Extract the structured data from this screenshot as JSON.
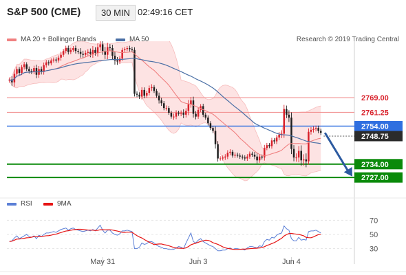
{
  "header": {
    "symbol": "S&P 500 (CME)",
    "timeframe": "30 MIN",
    "time": "02:49:16 CET"
  },
  "legend": {
    "ma20_label": "MA 20 + Bollinger Bands",
    "ma50_label": "MA 50",
    "rsi_label": "RSI",
    "rsi_ma_label": "9MA"
  },
  "credit": "Research © 2019 Trading Central",
  "colors": {
    "up": "#d8202a",
    "down": "#1f1f1f",
    "ma20": "#f08080",
    "band_fill": "#fde3e3",
    "ma50": "#4a6fa5",
    "resistance": "#f08a8a",
    "support": "#0a8a0a",
    "pivot": "#2f6fe0",
    "current": "#2b2b2b",
    "arrow": "#2c5aa0",
    "rsi": "#5b7fd6",
    "rsi_ma": "#e61414"
  },
  "chart_data": [
    {
      "type": "candlestick",
      "title": "S&P 500 (CME) 30 MIN",
      "x_labels": [
        "May 31",
        "Jun 3",
        "Jun 4"
      ],
      "ylim": [
        2722,
        2795
      ],
      "y_axis_side": "right",
      "grid": false,
      "legend_position": "top-left",
      "price_levels": [
        {
          "label": "2769.00",
          "value": 2769.0,
          "kind": "resistance"
        },
        {
          "label": "2761.25",
          "value": 2761.25,
          "kind": "resistance"
        },
        {
          "label": "2754.00",
          "value": 2754.0,
          "kind": "pivot"
        },
        {
          "label": "2748.75",
          "value": 2748.75,
          "kind": "current"
        },
        {
          "label": "2734.00",
          "value": 2734.0,
          "kind": "support"
        },
        {
          "label": "2727.00",
          "value": 2727.0,
          "kind": "support"
        }
      ],
      "forecast_arrow": {
        "from": 2750.5,
        "to": 2727.5
      },
      "close": [
        2778.5,
        2777.0,
        2781.5,
        2784.0,
        2782.0,
        2785.0,
        2786.5,
        2784.0,
        2783.0,
        2782.5,
        2784.5,
        2781.0,
        2784.0,
        2782.5,
        2786.0,
        2787.5,
        2787.0,
        2788.5,
        2789.0,
        2788.5,
        2790.0,
        2791.5,
        2793.5,
        2795.0,
        2793.0,
        2794.0,
        2795.0,
        2793.5,
        2793.0,
        2792.0,
        2791.5,
        2792.5,
        2793.0,
        2792.0,
        2794.0,
        2792.5,
        2795.5,
        2797.0,
        2793.5,
        2791.5,
        2795.5,
        2795.0,
        2791.0,
        2788.5,
        2788.0,
        2789.5,
        2794.0,
        2794.5,
        2795.0,
        2794.5,
        2794.0,
        2771.0,
        2770.5,
        2769.5,
        2773.0,
        2770.0,
        2771.5,
        2774.0,
        2774.5,
        2772.5,
        2770.0,
        2767.5,
        2766.0,
        2763.5,
        2763.5,
        2761.0,
        2759.0,
        2759.0,
        2761.0,
        2760.5,
        2761.0,
        2760.0,
        2762.0,
        2765.5,
        2767.5,
        2760.5,
        2759.0,
        2762.5,
        2764.5,
        2760.0,
        2758.5,
        2755.5,
        2753.0,
        2751.5,
        2744.5,
        2737.0,
        2737.0,
        2737.5,
        2738.0,
        2740.0,
        2740.5,
        2738.5,
        2739.0,
        2738.5,
        2738.0,
        2737.5,
        2737.0,
        2738.0,
        2739.5,
        2739.0,
        2738.0,
        2736.0,
        2738.0,
        2737.5,
        2742.5,
        2744.0,
        2743.5,
        2746.5,
        2746.0,
        2748.0,
        2749.5,
        2750.0,
        2763.0,
        2760.0,
        2758.5,
        2742.0,
        2737.5,
        2737.5,
        2741.0,
        2736.0,
        2736.5,
        2735.5,
        2751.0,
        2752.0,
        2752.5,
        2753.0,
        2751.5,
        2750.5
      ],
      "volatility": [
        1.2,
        2.0,
        2.5,
        1.5,
        1.2,
        1.3,
        1.4,
        1.2,
        1.5,
        1.3,
        1.4,
        2.0,
        1.8,
        1.5,
        1.6,
        1.4,
        1.3,
        1.2,
        1.2,
        1.3,
        1.3,
        1.8,
        1.2,
        1.4,
        1.5,
        1.3,
        1.2,
        1.5,
        1.3,
        2.2,
        1.8,
        1.4,
        1.6,
        2.0,
        2.3,
        1.6,
        2.2,
        2.0,
        2.2,
        2.4,
        2.6,
        1.8,
        2.0,
        2.4,
        2.0,
        1.5,
        1.3,
        1.2,
        1.2,
        1.4,
        1.3,
        1.6,
        1.4,
        1.4,
        1.6,
        1.5,
        1.2,
        1.5,
        1.7,
        1.2,
        1.2,
        1.8,
        1.5,
        1.3,
        1.5,
        1.2,
        1.2,
        1.8,
        1.5,
        1.2,
        1.4,
        2.0,
        1.6,
        2.5,
        2.0,
        2.2,
        1.6,
        1.3,
        1.2,
        1.4,
        1.2,
        1.3,
        1.2,
        1.3,
        2.5,
        1.8,
        1.3,
        1.2,
        1.4,
        1.5,
        1.5,
        1.2,
        1.4,
        1.2,
        1.3,
        1.2,
        1.3,
        1.4,
        1.3,
        1.2,
        1.6,
        1.8,
        1.4,
        1.2,
        1.8,
        1.3,
        1.2,
        1.5,
        1.4,
        1.6,
        1.6,
        2.0,
        2.4,
        2.0,
        2.6,
        3.0,
        2.2,
        2.4,
        2.8,
        3.2,
        3.0,
        3.5,
        2.0,
        1.6,
        1.5,
        1.4,
        1.4,
        1.3
      ]
    },
    {
      "type": "line",
      "title": "RSI",
      "ylim": [
        20,
        80
      ],
      "y_ticks": [
        "70",
        "50",
        "30"
      ],
      "y_tick_values": [
        70,
        50,
        30
      ],
      "series": [
        {
          "name": "RSI"
        },
        {
          "name": "9MA"
        }
      ],
      "rsi_values": [
        40,
        41,
        45,
        48,
        44,
        46,
        48,
        50,
        47,
        46,
        48,
        44,
        49,
        47,
        50,
        52,
        52,
        53,
        54,
        53,
        55,
        57,
        58,
        59,
        56,
        58,
        59,
        57,
        56,
        55,
        54,
        55,
        56,
        55,
        57,
        55,
        59,
        63,
        56,
        52,
        56,
        56,
        52,
        50,
        49,
        51,
        55,
        55,
        56,
        55,
        54,
        30,
        30,
        32,
        38,
        36,
        37,
        40,
        40,
        38,
        35,
        33,
        32,
        30,
        30,
        29,
        29,
        29,
        31,
        33,
        32,
        30,
        38,
        45,
        52,
        40,
        38,
        42,
        44,
        40,
        38,
        36,
        34,
        33,
        30,
        27,
        27,
        28,
        28,
        30,
        31,
        29,
        30,
        30,
        29,
        29,
        28,
        31,
        33,
        33,
        32,
        31,
        34,
        33,
        40,
        43,
        42,
        46,
        45,
        49,
        51,
        52,
        62,
        58,
        56,
        44,
        41,
        41,
        46,
        42,
        43,
        42,
        54,
        55,
        55,
        56,
        54,
        52
      ]
    }
  ]
}
